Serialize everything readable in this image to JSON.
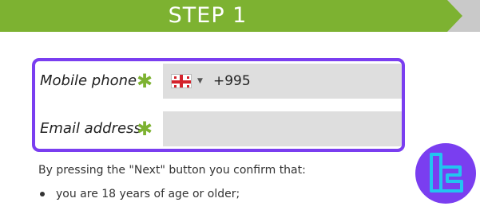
{
  "step": {
    "title": "STEP 1"
  },
  "form": {
    "phone": {
      "label": "Mobile phone",
      "required_mark": "✱",
      "country_flag": "georgia-flag-icon",
      "dial_code": "+995"
    },
    "email": {
      "label": "Email address",
      "required_mark": "✱",
      "value": ""
    }
  },
  "consent": {
    "intro": "By pressing the \"Next\" button you confirm that:",
    "items": [
      "you are 18 years of age or older;"
    ]
  },
  "colors": {
    "banner_green": "#7db231",
    "highlight_purple": "#7a3ef0",
    "logo_cyan": "#22c4f0"
  }
}
